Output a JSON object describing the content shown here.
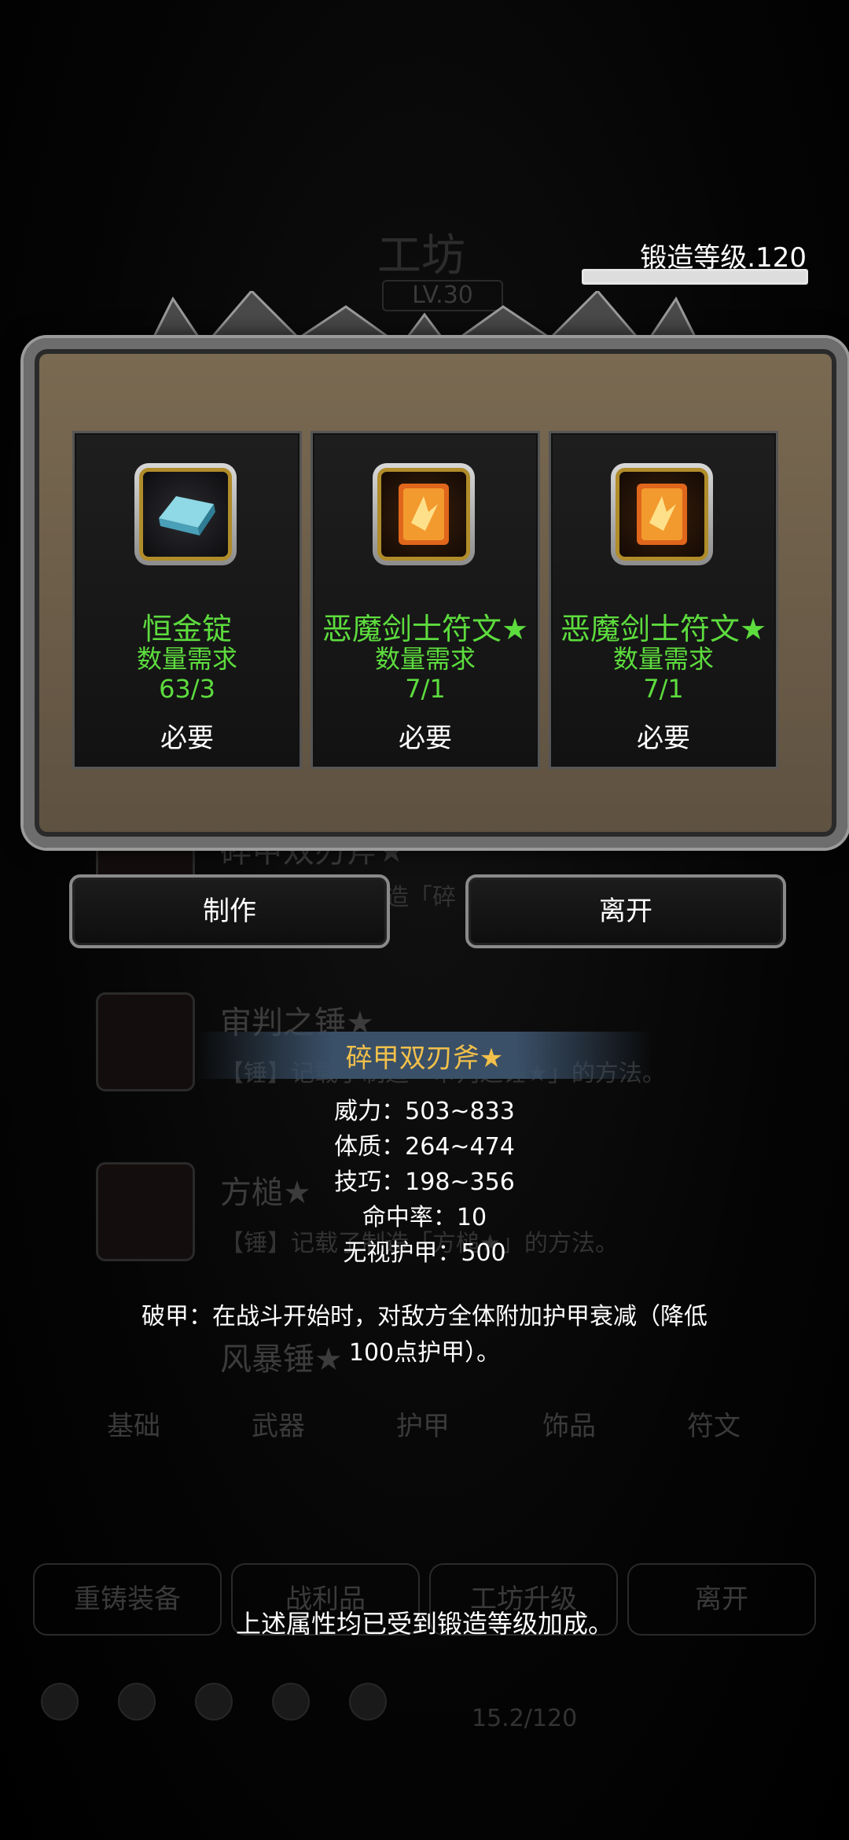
{
  "background": {
    "workshop_title": "工坊",
    "workshop_level": "LV.30",
    "items": [
      {
        "name": "碎甲双刃斧★",
        "desc": "【斧】记载了制造「碎"
      },
      {
        "name": "审判之锤★",
        "desc": "【锤】记载了制造「审判之锤★」的方法。"
      },
      {
        "name": "方槌★",
        "desc": "【锤】记载了制造「方槌★」的方法。"
      },
      {
        "name": "风暴锤★",
        "desc": ""
      }
    ],
    "tabs": [
      "基础",
      "武器",
      "护甲",
      "饰品",
      "符文"
    ],
    "buttons": [
      "重铸装备",
      "战利品",
      "工坊升级",
      "离开"
    ],
    "bottom_value": "15.2/120"
  },
  "forge": {
    "label": "锻造等级.120",
    "progress": 1.0
  },
  "materials": [
    {
      "name": "恒金锭",
      "req_label": "数量需求",
      "count": "63/3",
      "need": "必要",
      "icon": "ingot-icon"
    },
    {
      "name": "恶魔剑士符文★",
      "req_label": "数量需求",
      "count": "7/1",
      "need": "必要",
      "icon": "rune-icon"
    },
    {
      "name": "恶魔剑士符文★",
      "req_label": "数量需求",
      "count": "7/1",
      "need": "必要",
      "icon": "rune-icon"
    }
  ],
  "actions": {
    "craft": "制作",
    "leave": "离开"
  },
  "tooltip": {
    "title": "碎甲双刃斧★",
    "stats": [
      "威力：503~833",
      "体质：264~474",
      "技巧：198~356",
      "命中率：10",
      "无视护甲：500"
    ],
    "description_line1": "破甲：在战斗开始时，对敌方全体附加护甲衰减（降低",
    "description_line2": "100点护甲）。",
    "footnote": "上述属性均已受到锻造等级加成。"
  },
  "colors": {
    "material_text": "#5ddc3e",
    "title_gold": "#f2c04a",
    "frame_parchment": "#6b5c47"
  }
}
